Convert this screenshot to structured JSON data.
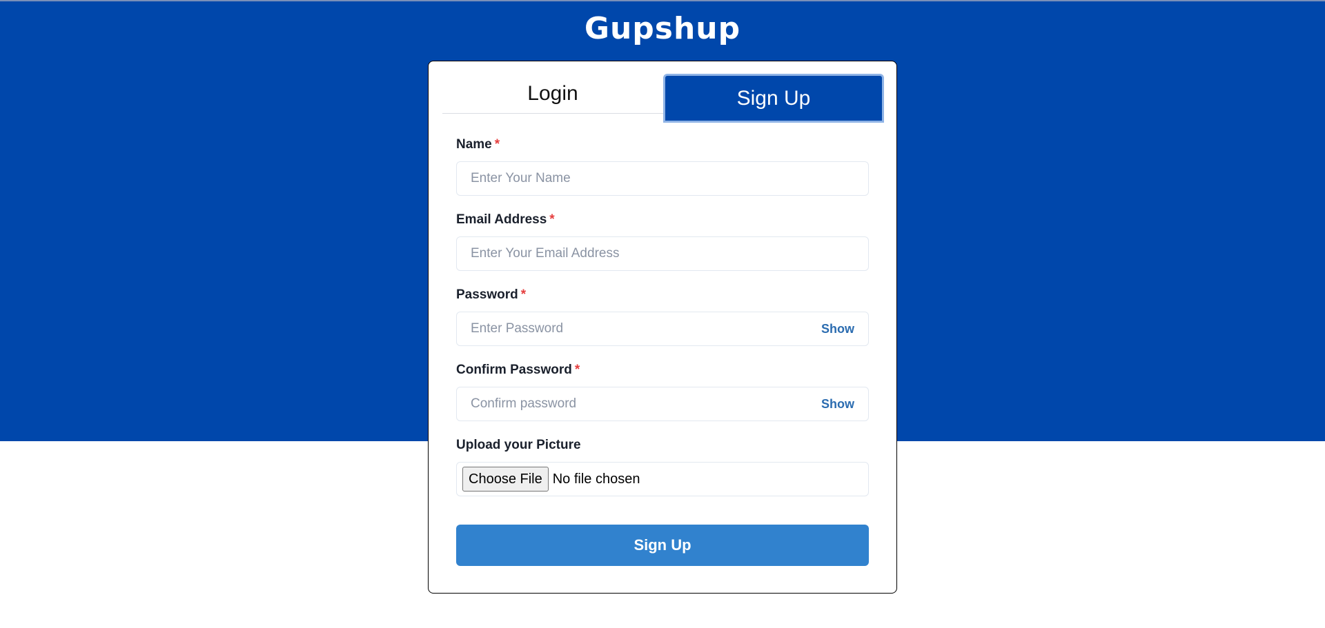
{
  "app": {
    "title": "Gupshup"
  },
  "tabs": [
    {
      "label": "Login",
      "active": false
    },
    {
      "label": "Sign Up",
      "active": true
    }
  ],
  "form": {
    "name": {
      "label": "Name",
      "required_mark": "*",
      "placeholder": "Enter Your Name",
      "value": ""
    },
    "email": {
      "label": "Email Address",
      "required_mark": "*",
      "placeholder": "Enter Your Email Address",
      "value": ""
    },
    "password": {
      "label": "Password",
      "required_mark": "*",
      "placeholder": "Enter Password",
      "value": "",
      "toggle_label": "Show"
    },
    "confirm_password": {
      "label": "Confirm Password",
      "required_mark": "*",
      "placeholder": "Confirm password",
      "value": "",
      "toggle_label": "Show"
    },
    "picture": {
      "label": "Upload your Picture",
      "button_label": "Choose File",
      "status": "No file chosen"
    },
    "submit_label": "Sign Up"
  },
  "colors": {
    "banner": "#0047AB",
    "active_tab": "#0047AB",
    "submit_button": "#3182ce",
    "required_mark": "#e53e3e",
    "toggle_text": "#2b6cb0"
  }
}
